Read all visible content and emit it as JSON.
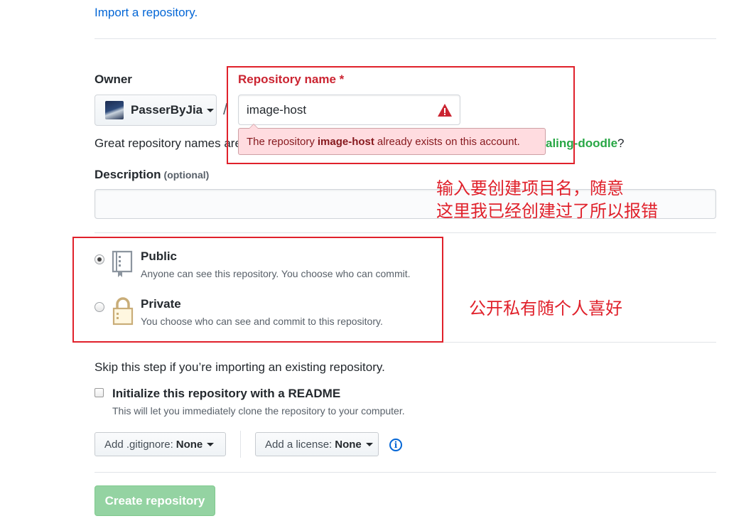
{
  "top": {
    "import_link": "Import a repository."
  },
  "owner": {
    "label": "Owner",
    "name": "PasserByJia"
  },
  "separator": "/",
  "repository": {
    "label": "Repository name *",
    "value": "image-host",
    "error_prefix": "The repository",
    "error_name": "image-host",
    "error_suffix": "already exists on this account."
  },
  "suggestion": {
    "prefix": "Great repository names are short and memorable. Need inspiration? How about",
    "tail_name": "aling-doodle",
    "tail_mark": "?"
  },
  "description": {
    "label": "Description",
    "optional": "(optional)",
    "value": ""
  },
  "visibility": {
    "public_title": "Public",
    "public_note": "Anyone can see this repository. You choose who can commit.",
    "private_title": "Private",
    "private_note": "You choose who can see and commit to this repository.",
    "selected": "public"
  },
  "init": {
    "skip_text": "Skip this step if you’re importing an existing repository.",
    "readme_title": "Initialize this repository with a README",
    "readme_note": "This will let you immediately clone the repository to your computer.",
    "readme_checked": false
  },
  "gitignore": {
    "label": "Add .gitignore:",
    "value": "None"
  },
  "license": {
    "label": "Add a license:",
    "value": "None"
  },
  "create_button": "Create repository",
  "annotations": {
    "name_line1": "输入要创建项目名，随意",
    "name_line2": "这里我已经创建过了所以报错",
    "visibility": "公开私有随个人喜好"
  },
  "colors": {
    "link": "#0366d6",
    "error": "#cb2431",
    "annotation": "#e0212b",
    "create_button": "#94d3a2",
    "suggestion": "#28a745"
  }
}
